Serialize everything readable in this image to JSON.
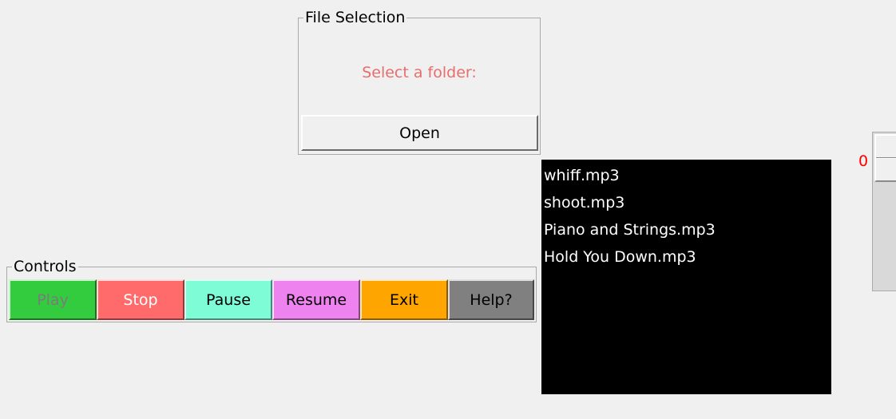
{
  "file_selection": {
    "group_label": "File Selection",
    "prompt": "Select a folder:",
    "prompt_color": "#e86d6d",
    "open_label": "Open"
  },
  "controls": {
    "group_label": "Controls",
    "buttons": [
      {
        "label": "Play",
        "bg": "#33cc3e",
        "fg": "#7b7b7b"
      },
      {
        "label": "Stop",
        "bg": "#ff6b6b",
        "fg": "#ffffff"
      },
      {
        "label": "Pause",
        "bg": "#7dfcd6",
        "fg": "#000000"
      },
      {
        "label": "Resume",
        "bg": "#ee82ee",
        "fg": "#000000"
      },
      {
        "label": "Exit",
        "bg": "#ffa500",
        "fg": "#000000"
      },
      {
        "label": "Help?",
        "bg": "#808080",
        "fg": "#000000"
      }
    ]
  },
  "playlist": {
    "items": [
      "whiff.mp3",
      "shoot.mp3",
      "Piano and Strings.mp3",
      "Hold You Down.mp3"
    ],
    "bg": "#000000",
    "fg": "#ffffff"
  },
  "volume": {
    "value": "0",
    "value_color": "#ff0000"
  }
}
